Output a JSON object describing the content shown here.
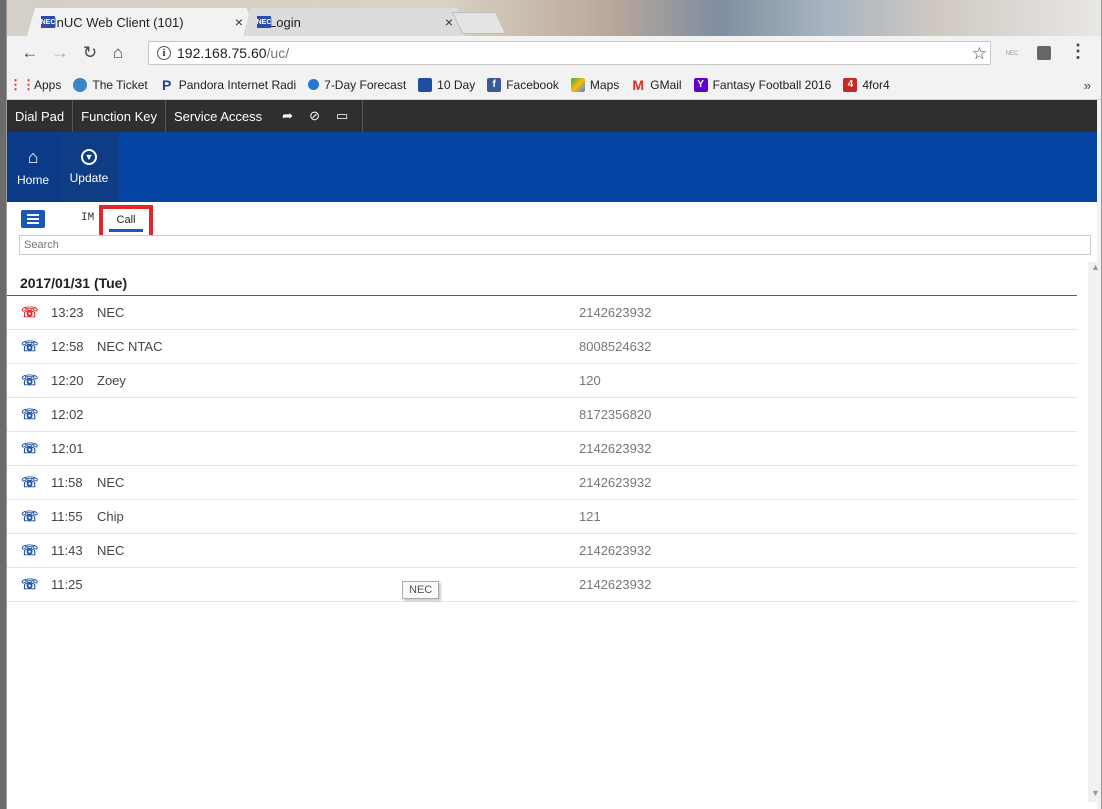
{
  "browser": {
    "tabs": [
      {
        "title": "InUC Web Client (101)",
        "favicon": "NEC",
        "close": "×"
      },
      {
        "title": "Login",
        "favicon": "NEC",
        "close": "×"
      }
    ],
    "url_host": "192.168.75.60",
    "url_path": "/uc/",
    "bookmarks": [
      {
        "label": "Apps",
        "icon": "apps-grid-icon",
        "color": "#d93025"
      },
      {
        "label": "The Ticket",
        "icon": "the-ticket-icon",
        "color": "#3a86c8"
      },
      {
        "label": "Pandora Internet Radi",
        "icon": "pandora-icon",
        "color": "#224099"
      },
      {
        "label": "7-Day Forecast",
        "icon": "forecast-icon",
        "color": "#2a75d3"
      },
      {
        "label": "10 Day",
        "icon": "weather-channel-icon",
        "color": "#1c4f9c"
      },
      {
        "label": "Facebook",
        "icon": "facebook-icon",
        "color": "#3b5998"
      },
      {
        "label": "Maps",
        "icon": "maps-icon",
        "color": "#34a853"
      },
      {
        "label": "GMail",
        "icon": "gmail-icon",
        "color": "#d93025"
      },
      {
        "label": "Fantasy Football 2016",
        "icon": "yahoo-icon",
        "color": "#5f01d1"
      },
      {
        "label": "4for4",
        "icon": "4for4-icon",
        "color": "#c62828"
      }
    ],
    "bookmarks_more": "»"
  },
  "app": {
    "topnav": {
      "dial_pad": "Dial Pad",
      "function_key": "Function Key",
      "service_access": "Service Access"
    },
    "blue": {
      "home": "Home",
      "update": "Update"
    },
    "tabs": {
      "im": "IM",
      "call": "Call"
    },
    "search_placeholder": "Search",
    "date_header": "2017/01/31 (Tue)",
    "calls": [
      {
        "time": "13:23",
        "name": "NEC",
        "number": "2142623932",
        "type": "missed"
      },
      {
        "time": "12:58",
        "name": "NEC NTAC",
        "number": "8008524632",
        "type": "normal"
      },
      {
        "time": "12:20",
        "name": "Zoey",
        "number": "120",
        "type": "normal"
      },
      {
        "time": "12:02",
        "name": "",
        "number": "8172356820",
        "type": "normal"
      },
      {
        "time": "12:01",
        "name": "",
        "number": "2142623932",
        "type": "normal"
      },
      {
        "time": "11:58",
        "name": "NEC",
        "number": "2142623932",
        "type": "normal"
      },
      {
        "time": "11:55",
        "name": "Chip",
        "number": "121",
        "type": "normal"
      },
      {
        "time": "11:43",
        "name": "NEC",
        "number": "2142623932",
        "type": "normal"
      },
      {
        "time": "11:25",
        "name": "",
        "number": "2142623932",
        "type": "normal"
      }
    ],
    "tooltip": "NEC"
  }
}
